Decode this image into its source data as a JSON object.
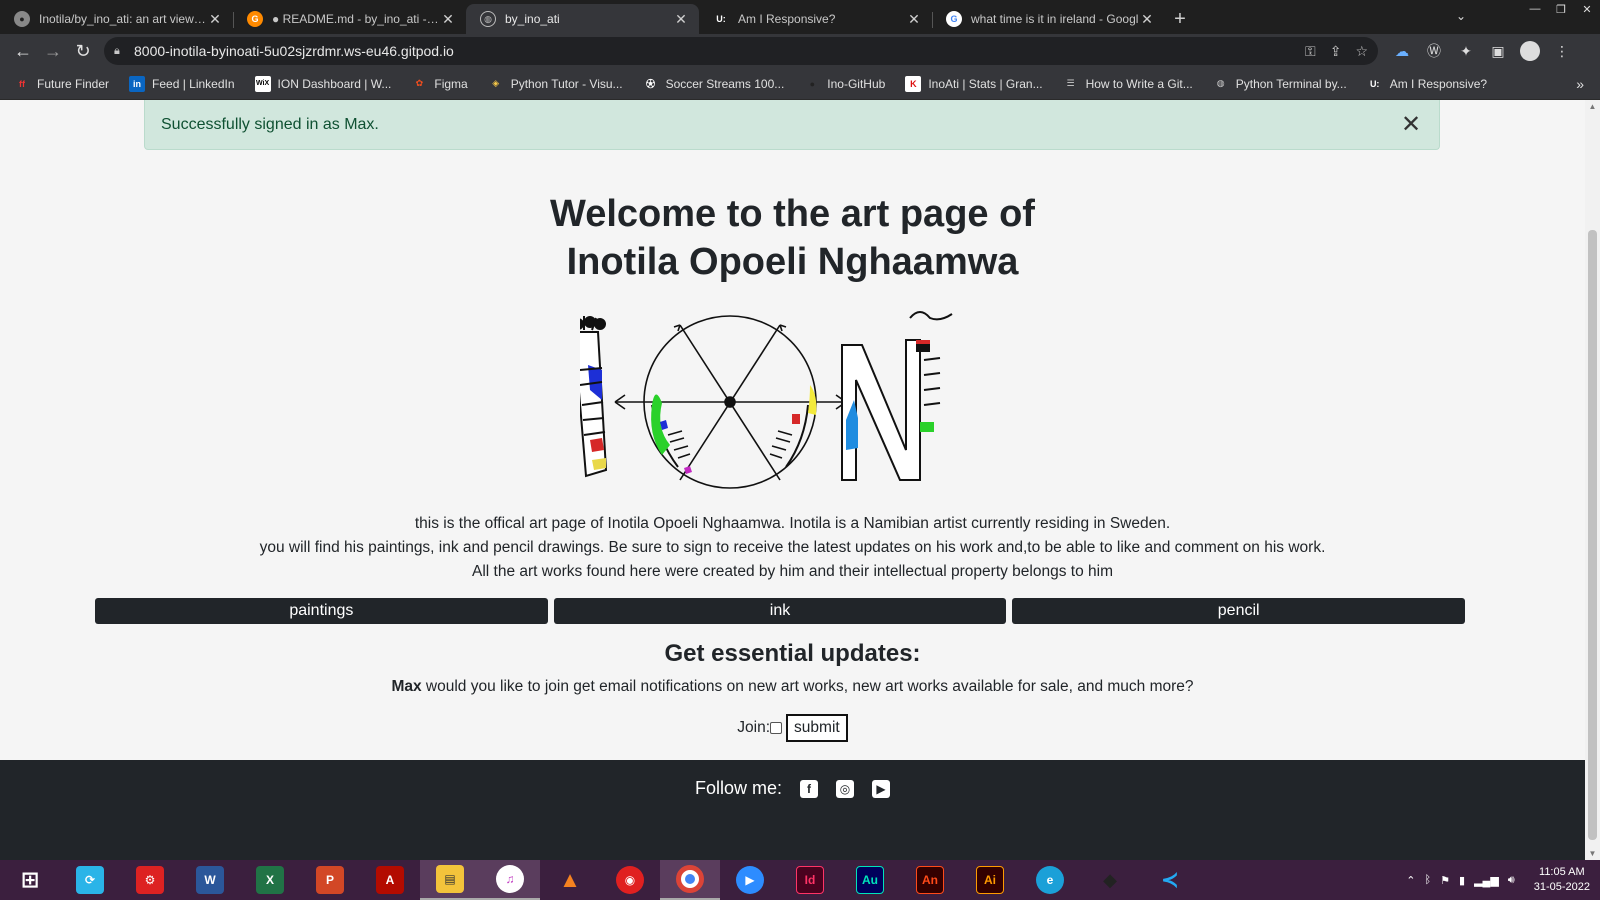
{
  "browser": {
    "tabs": [
      {
        "title": "Inotila/by_ino_ati: an art viewing",
        "icon": "github-icon",
        "active": false
      },
      {
        "title": "● README.md - by_ino_ati - Gitp",
        "icon": "gitpod-icon",
        "active": false
      },
      {
        "title": "by_ino_ati",
        "icon": "globe-icon",
        "active": true
      },
      {
        "title": "Am I Responsive?",
        "icon": "amiresponsive-icon",
        "active": false
      },
      {
        "title": "what time is it in ireland - Googl",
        "icon": "google-icon",
        "active": false
      }
    ],
    "url": "8000-inotila-byinoati-5u02sjzrdmr.ws-eu46.gitpod.io",
    "bookmarks": [
      {
        "label": "Future Finder",
        "icon": "future-finder-icon"
      },
      {
        "label": "Feed | LinkedIn",
        "icon": "linkedin-icon"
      },
      {
        "label": "ION Dashboard | W...",
        "icon": "wix-icon"
      },
      {
        "label": "Figma",
        "icon": "figma-icon"
      },
      {
        "label": "Python Tutor - Visu...",
        "icon": "python-icon"
      },
      {
        "label": "Soccer Streams 100...",
        "icon": "soccer-icon"
      },
      {
        "label": "Ino-GitHub",
        "icon": "github-icon"
      },
      {
        "label": "InoAti | Stats | Gran...",
        "icon": "k-icon"
      },
      {
        "label": "How to Write a Git...",
        "icon": "doc-icon"
      },
      {
        "label": "Python Terminal by...",
        "icon": "terminal-icon"
      },
      {
        "label": "Am I Responsive?",
        "icon": "amiresponsive-icon"
      }
    ]
  },
  "page": {
    "alert": "Successfully signed in as Max.",
    "heading_line1": "Welcome to the art page of",
    "heading_line2": "Inotila Opoeli Nghaamwa",
    "intro_line1": "this is the offical art page of Inotila Opoeli Nghaamwa. Inotila is a Namibian artist currently residing in Sweden.",
    "intro_line2": "you will find his paintings, ink and pencil drawings. Be sure to sign to receive the latest updates on his work and,to be able to like and comment on his work.",
    "intro_line3": "All the art works found here were created by him and their intellectual property belongs to him",
    "categories": [
      "paintings",
      "ink",
      "pencil"
    ],
    "updates_title": "Get essential updates:",
    "updates_user": "Max",
    "updates_text": " would you like to join get email notifications on new art works, new art works available for sale, and much more?",
    "join_label": "Join:",
    "submit_label": "submit",
    "follow_label": "Follow me:"
  },
  "taskbar": {
    "time": "11:05 AM",
    "date": "31-05-2022",
    "apps": [
      "Start",
      "Store",
      "Antivirus",
      "Word",
      "Excel",
      "PowerPoint",
      "Acrobat",
      "File Explorer",
      "iTunes",
      "VLC",
      "Cast",
      "Chrome",
      "Zoom",
      "InDesign",
      "Audition",
      "Animate",
      "Illustrator",
      "Edge",
      "Terminal",
      "VS Code"
    ]
  }
}
